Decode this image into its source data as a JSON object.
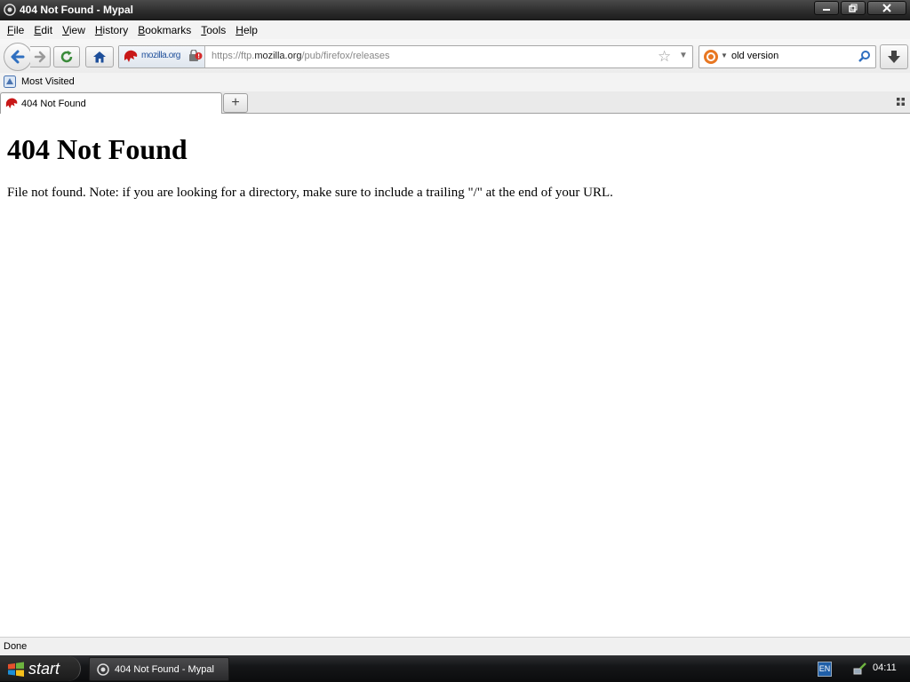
{
  "window": {
    "title": "404 Not Found - Mypal"
  },
  "menubar": {
    "items": [
      "File",
      "Edit",
      "View",
      "History",
      "Bookmarks",
      "Tools",
      "Help"
    ]
  },
  "navbar": {
    "identity_label": "mozilla.org",
    "url_prefix": "https://ftp.",
    "url_host": "mozilla.org",
    "url_path": "/pub/firefox/releases",
    "search_value": "old version"
  },
  "bookmarks": {
    "most_visited": "Most Visited"
  },
  "tabs": [
    {
      "label": "404 Not Found"
    }
  ],
  "page": {
    "heading": "404 Not Found",
    "message": "File not found. Note: if you are looking for a directory, make sure to include a trailing \"/\" at the end of your URL."
  },
  "status": {
    "text": "Done"
  },
  "taskbar": {
    "start_label": "start",
    "task_label": "404 Not Found - Mypal",
    "lang": "EN",
    "clock": "04:11"
  },
  "colors": {
    "accent": "#2f6fc0",
    "titlebar": "#2b2b2b",
    "taskbar": "#151618"
  }
}
